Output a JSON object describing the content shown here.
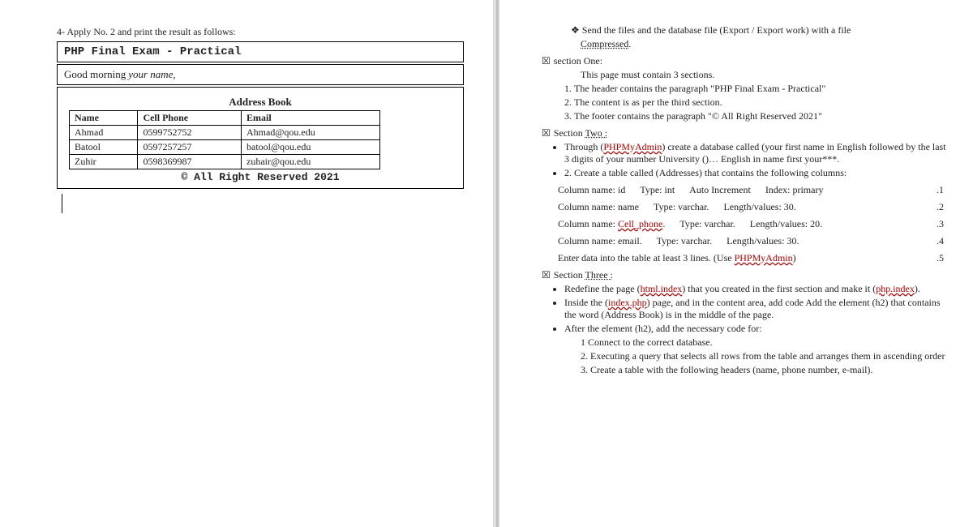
{
  "left": {
    "instruction": "4- Apply No. 2 and print the result as follows:",
    "title": "PHP Final Exam - Practical",
    "greeting_prefix": "Good morning",
    "greeting_var": "your name",
    "greeting_suffix": ",",
    "address_book_title": "Address Book",
    "headers": {
      "name": "Name",
      "phone": "Cell Phone",
      "email": "Email"
    },
    "rows": [
      {
        "name": "Ahmad",
        "phone": "0599752752",
        "email": "Ahmad@qou.edu"
      },
      {
        "name": "Batool",
        "phone": "0597257257",
        "email": "batool@qou.edu"
      },
      {
        "name": "Zuhir",
        "phone": "0598369987",
        "email": "zuhair@qou.edu"
      }
    ],
    "footer": "© All Right Reserved 2021"
  },
  "right": {
    "send_line_a": "Send the files and the database file (Export / Export work) with a file",
    "send_line_b": "Compressed",
    "section1_title": "section One:",
    "section1_sub": "This page must contain 3 sections.",
    "section1_items": [
      "The header contains the paragraph \"PHP Final Exam - Practical\"",
      "The content is as per the third section.",
      "The footer contains the paragraph \"© All Right Reserved 2021\""
    ],
    "section2_title_a": "Section ",
    "section2_title_b": "Two :",
    "section2_b1_a": "Through (",
    "section2_b1_b": "PHPMyAdmin",
    "section2_b1_c": ") create a database called (your first name in English followed by the last 3 digits of your number University ()… English in name first your***.",
    "section2_b2": "2. Create a table called (Addresses) that contains the following columns:",
    "cols": [
      {
        "name": "id",
        "type": "int",
        "extra": "Auto Increment",
        "index": "Index: primary",
        "n": ".1"
      },
      {
        "name": "name",
        "type": "varchar.",
        "extra": "Length/values: 30.",
        "index": "",
        "n": ".2"
      },
      {
        "name": "Cell_phone",
        "type": "varchar.",
        "extra": "Length/values: 20.",
        "index": "",
        "n": ".3",
        "under": true
      },
      {
        "name": "email.",
        "type": "varchar.",
        "extra": "Length/values: 30.",
        "index": "",
        "n": ".4"
      }
    ],
    "enter_data_a": "Enter data into the table at least 3 lines. (Use ",
    "enter_data_b": "PHPMyAdmin",
    "enter_data_c": ")",
    "enter_data_n": ".5",
    "section3_title_a": "Section ",
    "section3_title_b": "Three :",
    "s3_b1_a": "Redefine the page (",
    "s3_b1_b": "html.index",
    "s3_b1_c": ") that you created in the first section and make it (",
    "s3_b1_d": "php.index",
    "s3_b1_e": ").",
    "s3_b2_a": "Inside the (",
    "s3_b2_b": "index.php",
    "s3_b2_c": ") page, and in the content area, add code Add the element (h2) that contains the word (Address Book) is in the middle of the page.",
    "s3_b3": "After the element (h2), add the necessary code for:",
    "s3_sub": [
      "1 Connect to the correct database.",
      "2. Executing a query that selects all rows from the table and arranges them in ascending order",
      "3. Create a table with the following headers (name, phone number, e-mail)."
    ]
  }
}
